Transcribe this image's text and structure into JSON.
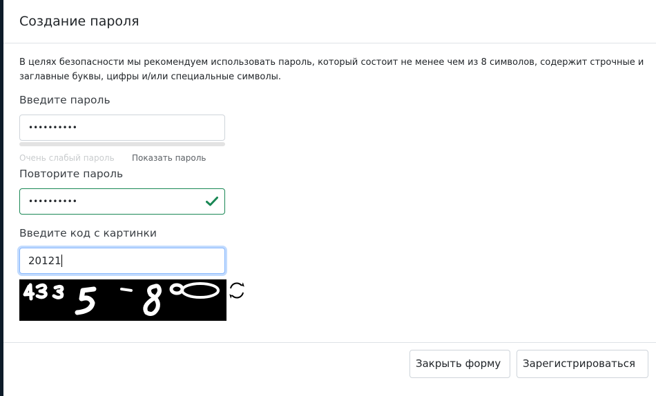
{
  "modal": {
    "title": "Создание пароля",
    "description": "В целях безопасности мы рекомендуем использовать пароль, который состоит не менее чем из 8 символов, содержит строчные и заглавные буквы, цифры и/или специальные символы."
  },
  "password": {
    "label": "Введите пароль",
    "value_masked": "••••••••••",
    "strength_text": "Очень слабый пароль",
    "show_password_label": "Показать пароль"
  },
  "repeat_password": {
    "label": "Повторите пароль",
    "value_masked": "••••••••••",
    "status_icon": "check-icon",
    "status_color": "#198754"
  },
  "captcha": {
    "label": "Введите код с картинки",
    "input_value": "20121",
    "image_text": "435 8°",
    "refresh_icon": "refresh-icon"
  },
  "footer": {
    "close_label": "Закрыть форму",
    "register_label": "Зарегистрироваться"
  }
}
